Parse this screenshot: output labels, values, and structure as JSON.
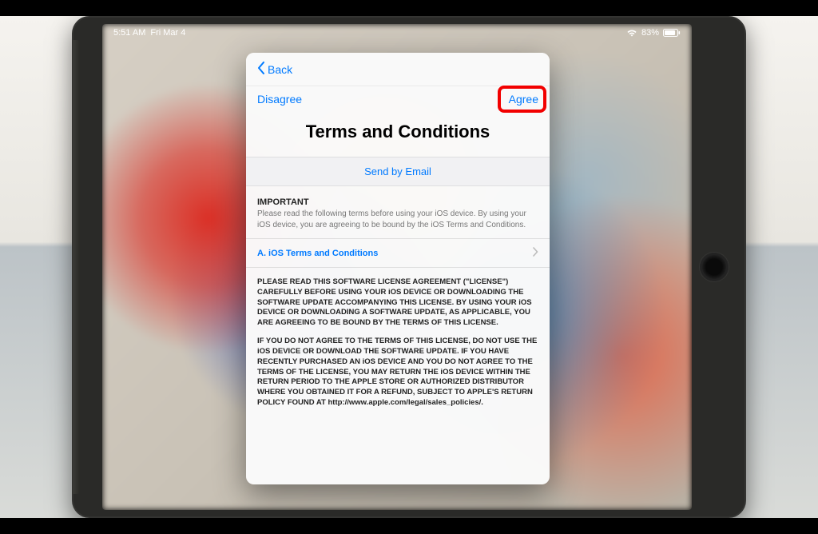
{
  "status": {
    "time": "5:51 AM",
    "date": "Fri Mar 4",
    "battery_pct": "83%"
  },
  "nav": {
    "back_label": "Back"
  },
  "actions": {
    "disagree": "Disagree",
    "agree": "Agree"
  },
  "sheet": {
    "title": "Terms and Conditions",
    "send_by_email": "Send by Email"
  },
  "important": {
    "heading": "IMPORTANT",
    "body": "Please read the following terms before using your iOS device. By using your iOS device, you are agreeing to be bound by the iOS Terms and Conditions."
  },
  "section_link": {
    "label": "A. iOS Terms and Conditions"
  },
  "license": {
    "p1": "PLEASE READ THIS SOFTWARE LICENSE AGREEMENT (\"LICENSE\") CAREFULLY BEFORE USING YOUR iOS DEVICE OR DOWNLOADING THE SOFTWARE UPDATE ACCOMPANYING THIS LICENSE. BY USING YOUR iOS DEVICE OR DOWNLOADING A SOFTWARE UPDATE, AS APPLICABLE, YOU ARE AGREEING TO BE BOUND BY THE TERMS OF THIS LICENSE.",
    "p2": "IF YOU DO NOT AGREE TO THE TERMS OF THIS LICENSE, DO NOT USE THE iOS DEVICE OR DOWNLOAD THE SOFTWARE UPDATE. IF YOU HAVE RECENTLY PURCHASED AN iOS DEVICE AND YOU DO NOT AGREE TO THE TERMS OF THE LICENSE, YOU MAY RETURN THE iOS DEVICE WITHIN THE RETURN PERIOD TO THE APPLE STORE OR AUTHORIZED DISTRIBUTOR WHERE YOU OBTAINED IT FOR A REFUND, SUBJECT TO APPLE'S RETURN POLICY FOUND AT http://www.apple.com/legal/sales_policies/."
  },
  "colors": {
    "accent": "#007aff",
    "highlight": "#f20000"
  }
}
